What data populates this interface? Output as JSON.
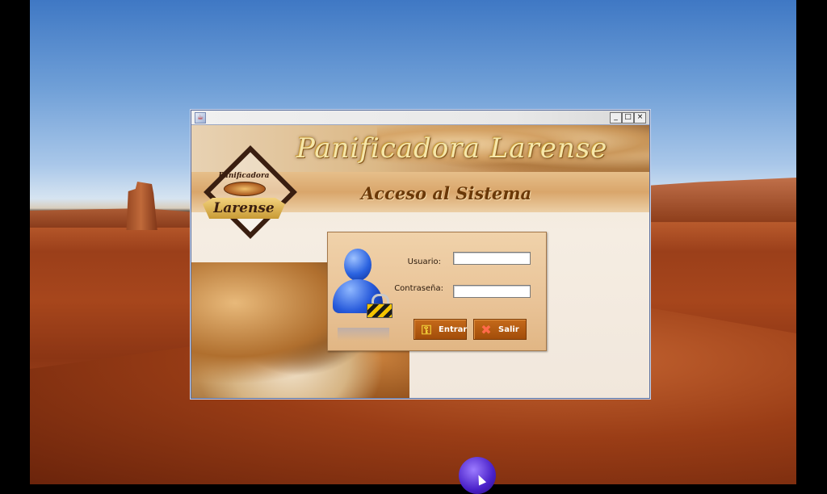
{
  "window": {
    "title_icon": "java-coffee-icon",
    "controls": {
      "minimize": "_",
      "maximize": "□",
      "close": "×"
    }
  },
  "header": {
    "brand_title": "Panificadora Larense",
    "section_title": "Acceso al Sistema"
  },
  "logo": {
    "top_text": "Panificadora",
    "main_text": "Larense"
  },
  "login": {
    "user_label": "Usuario:",
    "user_value": "",
    "password_label": "Contraseña:",
    "password_value": "",
    "enter_button": "Entrar",
    "exit_button": "Salir",
    "icons": {
      "user": "user-lock-icon",
      "enter": "key-icon",
      "exit": "x-icon"
    }
  },
  "colors": {
    "button_bg": "#b35b12",
    "title_text": "#6a3808",
    "panel_bg": "#e9c397"
  }
}
